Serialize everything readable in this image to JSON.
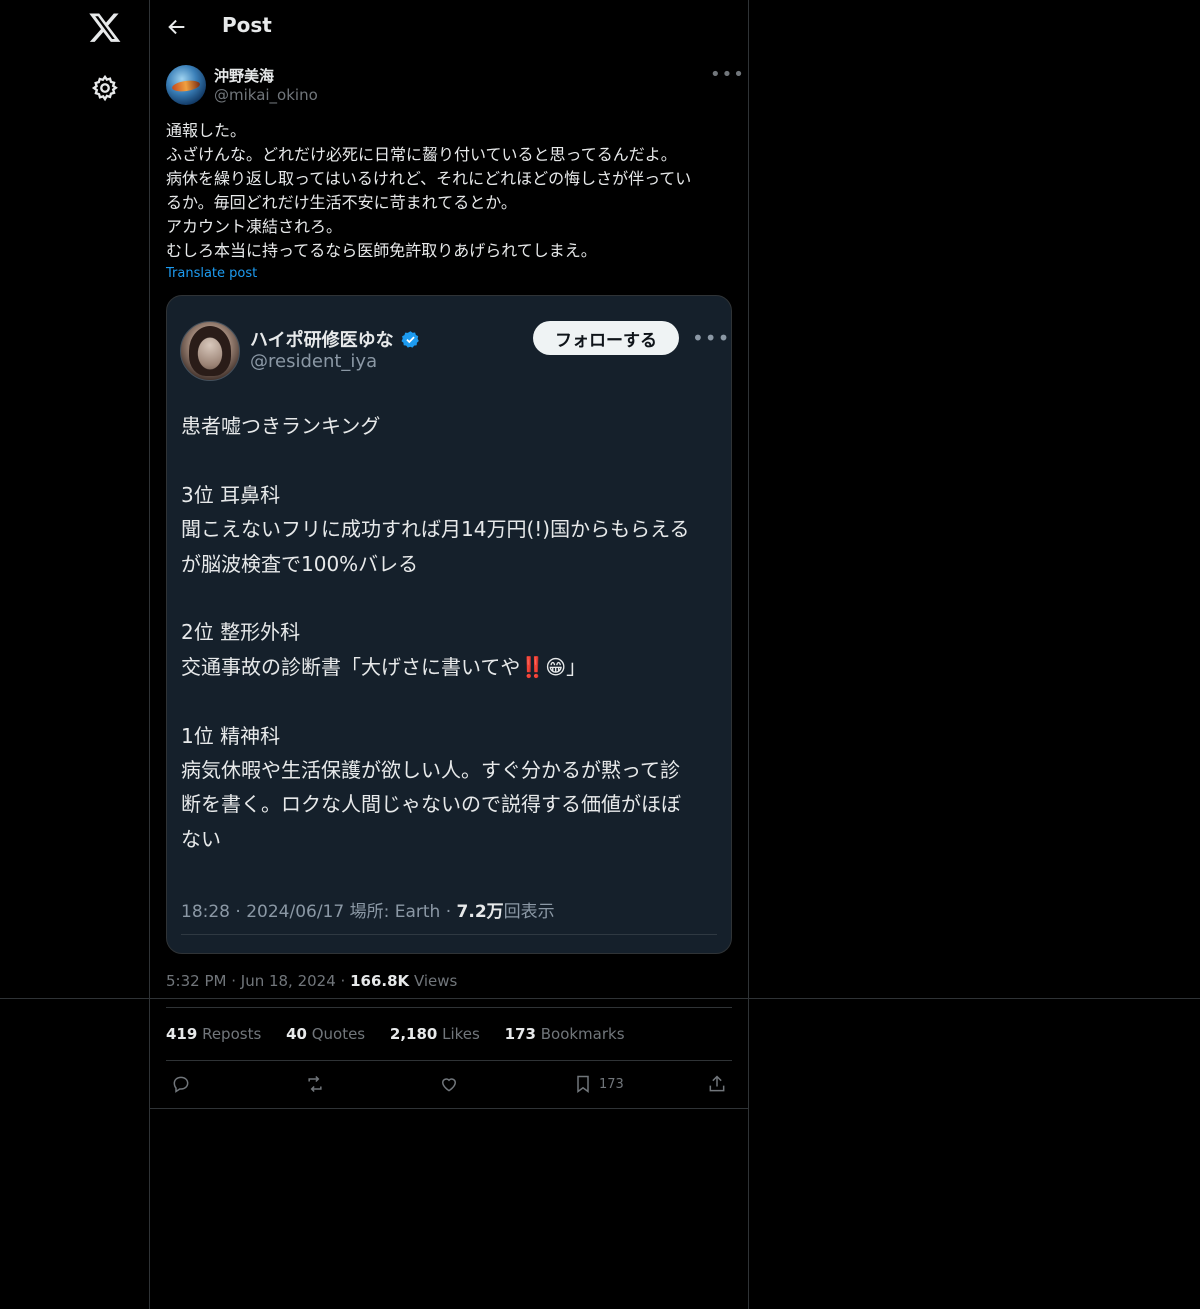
{
  "sidebar": {
    "logo_icon": "x-logo-icon",
    "settings_icon": "gear-icon"
  },
  "header": {
    "title": "Post"
  },
  "author": {
    "name": "沖野美海",
    "handle": "@mikai_okino"
  },
  "post": {
    "text": "通報した。\nふざけんな。どれだけ必死に日常に齧り付いていると思ってるんだよ。\n病休を繰り返し取ってはいるけれど、それにどれほどの悔しさが伴ってい\nるか。毎回どれだけ生活不安に苛まれてるとか。\nアカウント凍結されろ。\nむしろ本当に持ってるなら医師免許取りあげられてしまえ。",
    "translate": "Translate post"
  },
  "quoted": {
    "name": "ハイポ研修医ゆな",
    "handle": "@resident_iya",
    "follow_label": "フォローする",
    "body": "患者嘘つきランキング\n\n3位 耳鼻科\n聞こえないフリに成功すれば月14万円(!)国からもらえる\nが脳波検査で100%バレる\n\n2位 整形外科\n交通事故の診断書「大げさに書いてや‼️😁」\n\n1位 精神科\n病気休暇や生活保護が欲しい人。すぐ分かるが黙って診\n断を書く。ロクな人間じゃないので説得する価値がほぼ\nない",
    "meta_time": "18:28 · 2024/06/17  場所: Earth · ",
    "meta_views": "7.2万",
    "meta_views_label": "回表示"
  },
  "meta": {
    "time": "5:32 PM",
    "date": "Jun 18, 2024",
    "views": "166.8K",
    "views_label": " Views"
  },
  "stats": {
    "reposts": "419",
    "reposts_label": " Reposts",
    "quotes": "40",
    "quotes_label": " Quotes",
    "likes": "2,180",
    "likes_label": " Likes",
    "bookmarks": "173",
    "bookmarks_label": " Bookmarks"
  },
  "actions": {
    "bookmark_count": "173"
  }
}
